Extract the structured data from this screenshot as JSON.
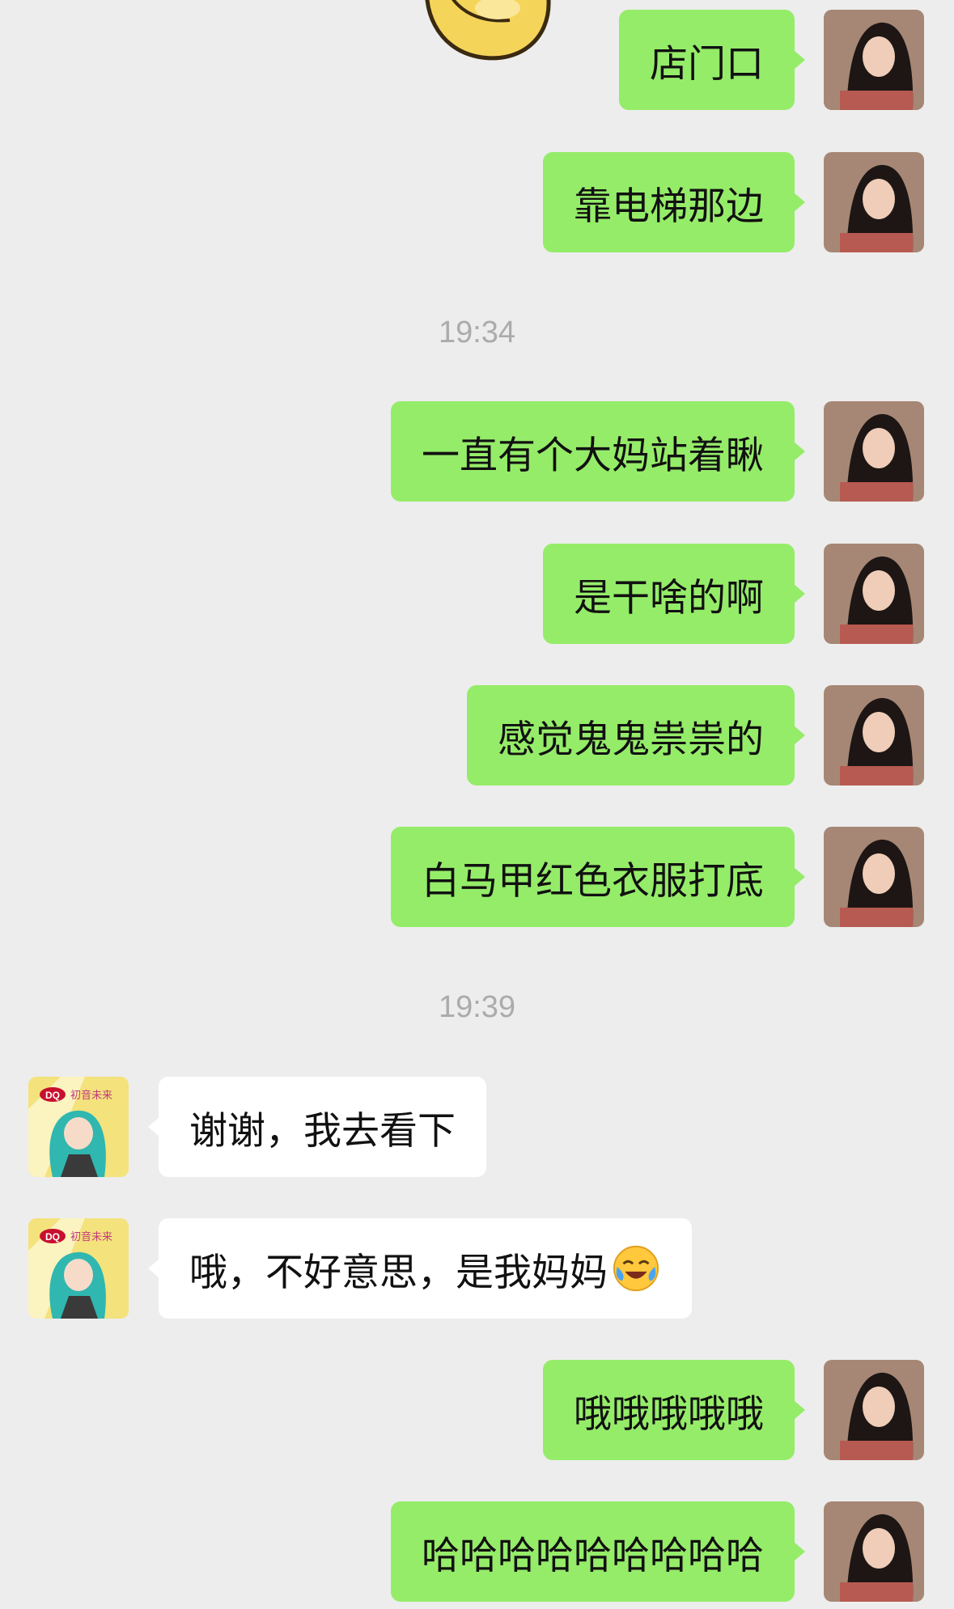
{
  "chat": {
    "colors": {
      "background": "#ededed",
      "my_bubble": "#95ec69",
      "their_bubble": "#ffffff",
      "timestamp_text": "#ababab"
    },
    "messages": [
      {
        "sender": "me",
        "text": "店门口"
      },
      {
        "sender": "me",
        "text": "靠电梯那边"
      },
      {
        "type": "timestamp",
        "text": "19:34"
      },
      {
        "sender": "me",
        "text": "一直有个大妈站着瞅"
      },
      {
        "sender": "me",
        "text": "是干啥的啊"
      },
      {
        "sender": "me",
        "text": "感觉鬼鬼祟祟的"
      },
      {
        "sender": "me",
        "text": "白马甲红色衣服打底"
      },
      {
        "type": "timestamp",
        "text": "19:39"
      },
      {
        "sender": "them",
        "text": "谢谢，我去看下"
      },
      {
        "sender": "them",
        "text": "哦，不好意思，是我妈妈",
        "emoji": "crying-laughing-emoji"
      },
      {
        "sender": "me",
        "text": "哦哦哦哦哦"
      },
      {
        "sender": "me",
        "text": "哈哈哈哈哈哈哈哈哈"
      }
    ],
    "their_avatar_badge": "DQ",
    "their_avatar_caption": "初音未来"
  }
}
